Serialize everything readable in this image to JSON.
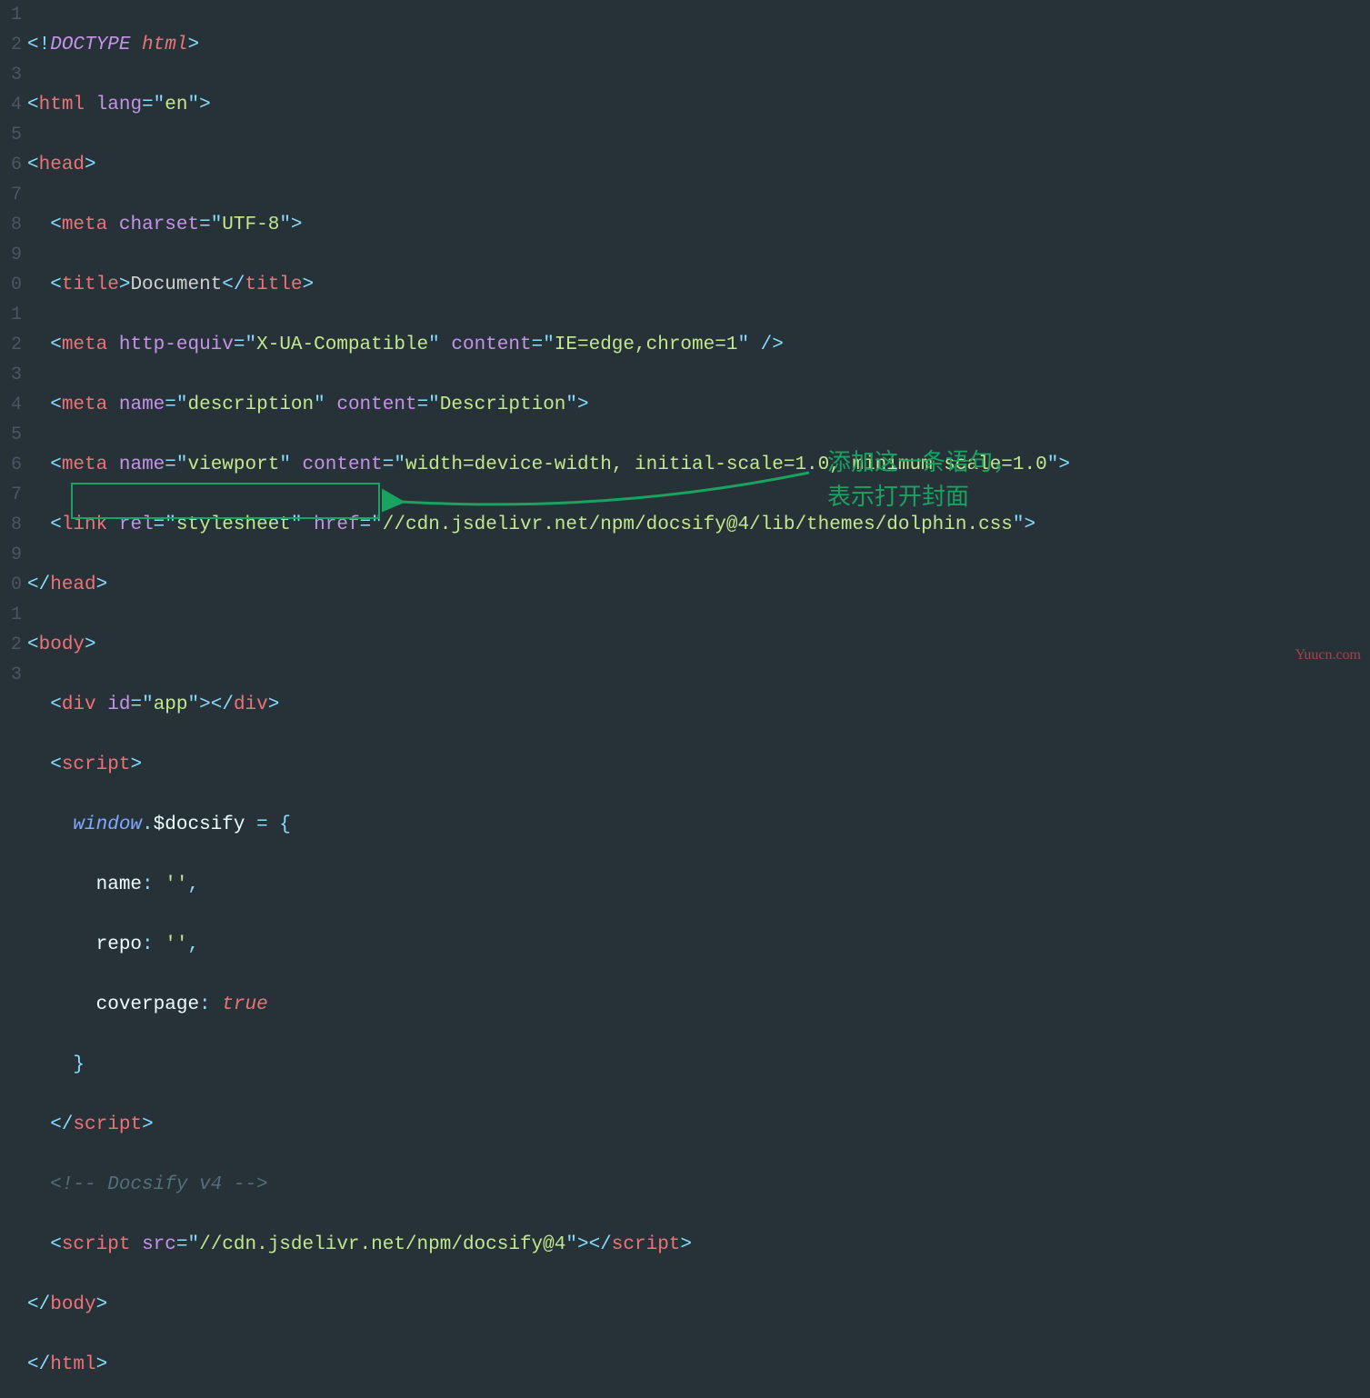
{
  "lineNumbers": [
    "1",
    "2",
    "3",
    "4",
    "5",
    "6",
    "7",
    "8",
    "9",
    "0",
    "1",
    "2",
    "3",
    "4",
    "5",
    "6",
    "7",
    "8",
    "9",
    "0",
    "1",
    "2",
    "3"
  ],
  "code": {
    "l1": {
      "doctype_open": "<!",
      "doctype": "DOCTYPE ",
      "html": "html",
      "close": ">"
    },
    "l2": {
      "open": "<",
      "tag": "html",
      "sp": " ",
      "attr": "lang",
      "eq": "=",
      "q": "\"",
      "val": "en",
      "close": ">"
    },
    "l3": {
      "open": "<",
      "tag": "head",
      "close": ">"
    },
    "l4": {
      "open": "<",
      "tag": "meta",
      "sp": " ",
      "attr": "charset",
      "eq": "=",
      "q": "\"",
      "val": "UTF-8",
      "close": ">"
    },
    "l5": {
      "open": "<",
      "tag": "title",
      "close": ">",
      "text": "Document",
      "copen": "</",
      "ctag": "title",
      "cclose": ">"
    },
    "l6": {
      "open": "<",
      "tag": "meta",
      "sp": " ",
      "attr1": "http-equiv",
      "eq": "=",
      "q": "\"",
      "val1": "X-UA-Compatible",
      "attr2": "content",
      "val2": "IE=edge,chrome=1",
      "selfclose": " />"
    },
    "l7": {
      "open": "<",
      "tag": "meta",
      "sp": " ",
      "attr1": "name",
      "val1": "description",
      "attr2": "content",
      "val2": "Description",
      "close": ">"
    },
    "l8": {
      "open": "<",
      "tag": "meta",
      "sp": " ",
      "attr1": "name",
      "val1": "viewport",
      "attr2": "content",
      "val2": "width=device-width, initial-scale=1.0, minimum-scale=1.0",
      "close": ">"
    },
    "l9": {
      "open": "<",
      "tag": "link",
      "sp": " ",
      "attr1": "rel",
      "val1": "stylesheet",
      "attr2": "href",
      "val2": "//cdn.jsdelivr.net/npm/docsify@4/lib/themes/dolphin.css",
      "close": ">"
    },
    "l10": {
      "open": "</",
      "tag": "head",
      "close": ">"
    },
    "l11": {
      "open": "<",
      "tag": "body",
      "close": ">"
    },
    "l12": {
      "open": "<",
      "tag": "div",
      "sp": " ",
      "attr": "id",
      "val": "app",
      "close": ">",
      "copen": "</",
      "ctag": "div",
      "cclose": ">"
    },
    "l13": {
      "open": "<",
      "tag": "script",
      "close": ">"
    },
    "l14": {
      "ident": "window",
      "dot": ".",
      "prop": "$docsify",
      "sp": " ",
      "eq": "=",
      "brace": " {"
    },
    "l15": {
      "key": "name",
      "colon": ":",
      "sp": " ",
      "val": "''",
      "comma": ","
    },
    "l16": {
      "key": "repo",
      "colon": ":",
      "sp": " ",
      "val": "''",
      "comma": ","
    },
    "l17": {
      "key": "coverpage",
      "colon": ":",
      "sp": " ",
      "val": "true"
    },
    "l18": {
      "brace": "}"
    },
    "l19": {
      "open": "</",
      "tag": "script",
      "close": ">"
    },
    "l20": {
      "cmt": "<!-- Docsify v4 -->"
    },
    "l21": {
      "open": "<",
      "tag": "script",
      "sp": " ",
      "attr": "src",
      "val": "//cdn.jsdelivr.net/npm/docsify@4",
      "close": ">",
      "copen": "</",
      "ctag": "script",
      "cclose": ">"
    },
    "l22": {
      "open": "</",
      "tag": "body",
      "close": ">"
    },
    "l23": {
      "open": "</",
      "tag": "html",
      "close": ">"
    }
  },
  "annotation": {
    "line1": "添加这一条语句，",
    "line2": "表示打开封面"
  },
  "watermark": "Yuucn.com"
}
